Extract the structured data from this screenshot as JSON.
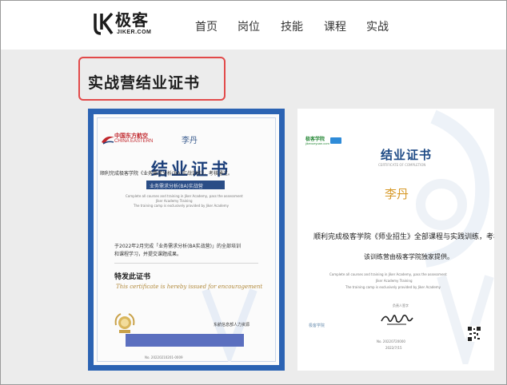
{
  "header": {
    "logo_cn": "极客",
    "logo_en": "JIKER.COM",
    "nav": [
      "首页",
      "岗位",
      "技能",
      "课程",
      "实战"
    ]
  },
  "main": {
    "page_title": "实战营结业证书"
  },
  "cert1": {
    "airline_cn": "中国东方航空",
    "airline_en": "CHINA EASTERN",
    "name": "李丹",
    "title": "结业证书",
    "line": "顺利完成极客学院《业务需求分析(BA)实战训练》，考核通过。",
    "band": "业务需求分析(BA)实战营",
    "en1": "Complete all courses and training in Jiker Academy, pass the assessment",
    "en2": "Jiker Academy  Training",
    "en3": "The training camp is exclusively provided by Jiker Academy",
    "body1": "于2022年2月完成「业务需求分析(BA实战营)」的全部培训",
    "body2": "和课程学习，并提交课题成果。",
    "special": "特发此证书",
    "script": "This certificate is hereby issued for encouragement",
    "issuer": "东航信息部人力资源",
    "no": "No. 20220210201-0009"
  },
  "cert2": {
    "logo_txt": "极客学院",
    "logo_sub": "jikexueyuan.com",
    "title": "结业证书",
    "sub": "CERTIFICATE OF COMPLETION",
    "name": "李丹",
    "line1": "顺利完成极客学院《师业招生》全部课程与实践训练，考核通过。",
    "line2": "该训练营由极客学院独家提供。",
    "en1": "Complete all courses and training in Jiker Academy, pass the assessment",
    "en2": "Jiker Academy  Training",
    "en3": "The training camp is exclusively provided by Jiker Academy",
    "signer_label": "负责人签字",
    "seal": "极客学院",
    "no": "No. 20220720000",
    "date": "2022/7/15"
  }
}
